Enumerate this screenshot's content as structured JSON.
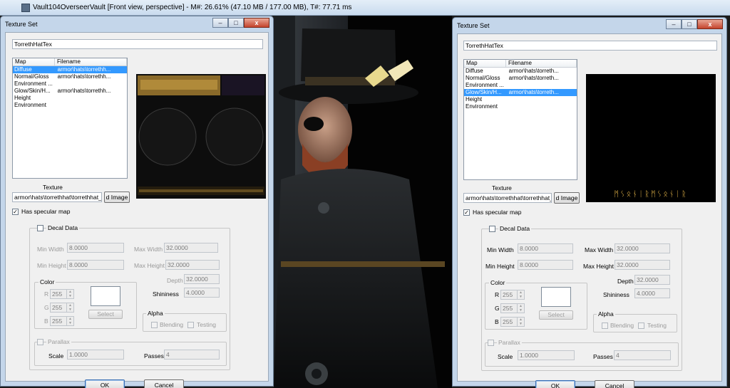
{
  "app": {
    "title": "Vault104OverseerVault [Front view, perspective] - M#: 26.61% (47.10 MB / 177.00 MB), T#: 77.71 ms"
  },
  "window_buttons": {
    "minimize": "–",
    "maximize": "□",
    "close": "x"
  },
  "dialogs": [
    {
      "title": "Texture Set",
      "name": "TorrethHatTex",
      "columns": [
        "Map",
        "Filename"
      ],
      "rows": [
        {
          "map": "Diffuse",
          "filename": "armor\\hats\\torrethh..."
        },
        {
          "map": "Normal/Gloss",
          "filename": "armor\\hats\\torrethh..."
        },
        {
          "map": "Environment ...",
          "filename": ""
        },
        {
          "map": "Glow/Skin/H...",
          "filename": "armor\\hats\\torrethh..."
        },
        {
          "map": "Height",
          "filename": ""
        },
        {
          "map": "Environment",
          "filename": ""
        }
      ],
      "selected_row": 0,
      "texture_label": "Texture",
      "texture_path": "armor\\hats\\torrethhat\\torrethhat_d",
      "image_button": "d Image",
      "has_specular_label": "Has specular map",
      "decal_label": "Decal Data",
      "min_width_label": "Min Width",
      "min_width": "8.0000",
      "max_width_label": "Max Width",
      "max_width": "32.0000",
      "min_height_label": "Min Height",
      "min_height": "8.0000",
      "max_height_label": "Max Height",
      "max_height": "32.0000",
      "depth_label": "Depth",
      "depth": "32.0000",
      "shininess_label": "Shininess",
      "shininess": "4.0000",
      "color_label": "Color",
      "r_label": "R",
      "g_label": "G",
      "b_label": "B",
      "r": "255",
      "g": "255",
      "b": "255",
      "select_label": "Select",
      "alpha_label": "Alpha",
      "blending_label": "Blending",
      "testing_label": "Testing",
      "parallax_label": "Parallax",
      "scale_label": "Scale",
      "scale": "1.0000",
      "passes_label": "Passes",
      "passes": "4",
      "ok_label": "OK",
      "cancel_label": "Cancel"
    },
    {
      "title": "Texture Set",
      "name": "TorrethHatTex",
      "columns": [
        "Map",
        "Filename"
      ],
      "rows": [
        {
          "map": "Diffuse",
          "filename": "armor\\hats\\torreth..."
        },
        {
          "map": "Normal/Gloss",
          "filename": "armor\\hats\\torreth..."
        },
        {
          "map": "Environment ...",
          "filename": ""
        },
        {
          "map": "Glow/Skin/H...",
          "filename": "armor\\hats\\torreth..."
        },
        {
          "map": "Height",
          "filename": ""
        },
        {
          "map": "Environment",
          "filename": ""
        }
      ],
      "selected_row": 3,
      "texture_label": "Texture",
      "texture_path": "armor\\hats\\torrethhat\\torrethhat_",
      "image_button": "d Image",
      "has_specular_label": "Has specular map",
      "decal_label": "Decal Data",
      "min_width_label": "Min Width",
      "min_width": "8.0000",
      "max_width_label": "Max Width",
      "max_width": "32.0000",
      "min_height_label": "Min Height",
      "min_height": "8.0000",
      "max_height_label": "Max Height",
      "max_height": "32.0000",
      "depth_label": "Depth",
      "depth": "32.0000",
      "shininess_label": "Shininess",
      "shininess": "4.0000",
      "color_label": "Color",
      "r_label": "R",
      "g_label": "G",
      "b_label": "B",
      "r": "255",
      "g": "255",
      "b": "255",
      "select_label": "Select",
      "alpha_label": "Alpha",
      "blending_label": "Blending",
      "testing_label": "Testing",
      "parallax_label": "Parallax",
      "scale_label": "Scale",
      "scale": "1.0000",
      "passes_label": "Passes",
      "passes": "4",
      "ok_label": "OK",
      "cancel_label": "Cancel",
      "glow_runes": "ᛗᛊᛟᚾᛁᚱᛗᛊᛟᚾᛁᚱ"
    }
  ],
  "colors": {
    "selection": "#3399ff",
    "frame": "#c4d6ea",
    "rune_gold": "#e8b84a"
  }
}
